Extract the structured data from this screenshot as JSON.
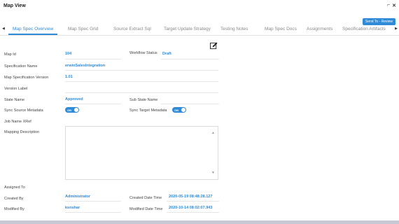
{
  "window": {
    "title": "Map View",
    "pin_icon": "pin-icon",
    "close_icon": "close-icon"
  },
  "actions": {
    "send_label": "Send To - Review"
  },
  "tabs": [
    {
      "label": "Map Spec Overview",
      "active": true
    },
    {
      "label": "Map Spec Grid"
    },
    {
      "label": "Source Extract Sql"
    },
    {
      "label": "Target Update Strategy"
    },
    {
      "label": "Testing Notes"
    },
    {
      "label": "Map Spec Docs"
    },
    {
      "label": "Assignments"
    },
    {
      "label": "Specification Artifacts"
    }
  ],
  "fields": {
    "map_id": {
      "label": "Map Id",
      "value": "104"
    },
    "workflow_status": {
      "label": "Workflow Status",
      "value": "Draft"
    },
    "spec_name": {
      "label": "Specification Name",
      "value": "erwinSalesIntegration"
    },
    "spec_version": {
      "label": "Map Specification Version",
      "value": "1.01"
    },
    "version_label": {
      "label": "Version Label",
      "value": ""
    },
    "state_name": {
      "label": "State Name",
      "value": "Approved"
    },
    "sub_state_name": {
      "label": "Sub State Name",
      "value": ""
    },
    "sync_source": {
      "label": "Sync Source Metadata",
      "value": "ON"
    },
    "sync_target": {
      "label": "Sync Target Metadata",
      "value": "ON"
    },
    "job_name_xref": {
      "label": "Job Name XRef",
      "value": ""
    },
    "mapping_description": {
      "label": "Mapping Description",
      "value": ""
    },
    "assigned_to": {
      "label": "Assigned To",
      "value": ""
    },
    "created_by": {
      "label": "Created By",
      "value": "Administrator"
    },
    "created_date": {
      "label": "Created Date Time",
      "value": "2020-05-19 08:48:28.127"
    },
    "modified_by": {
      "label": "Modified By",
      "value": "ksnshar"
    },
    "modified_date": {
      "label": "Modified Date Time",
      "value": "2020-10-14 08:02:07.943"
    }
  },
  "colors": {
    "accent": "#2f8ad8"
  }
}
